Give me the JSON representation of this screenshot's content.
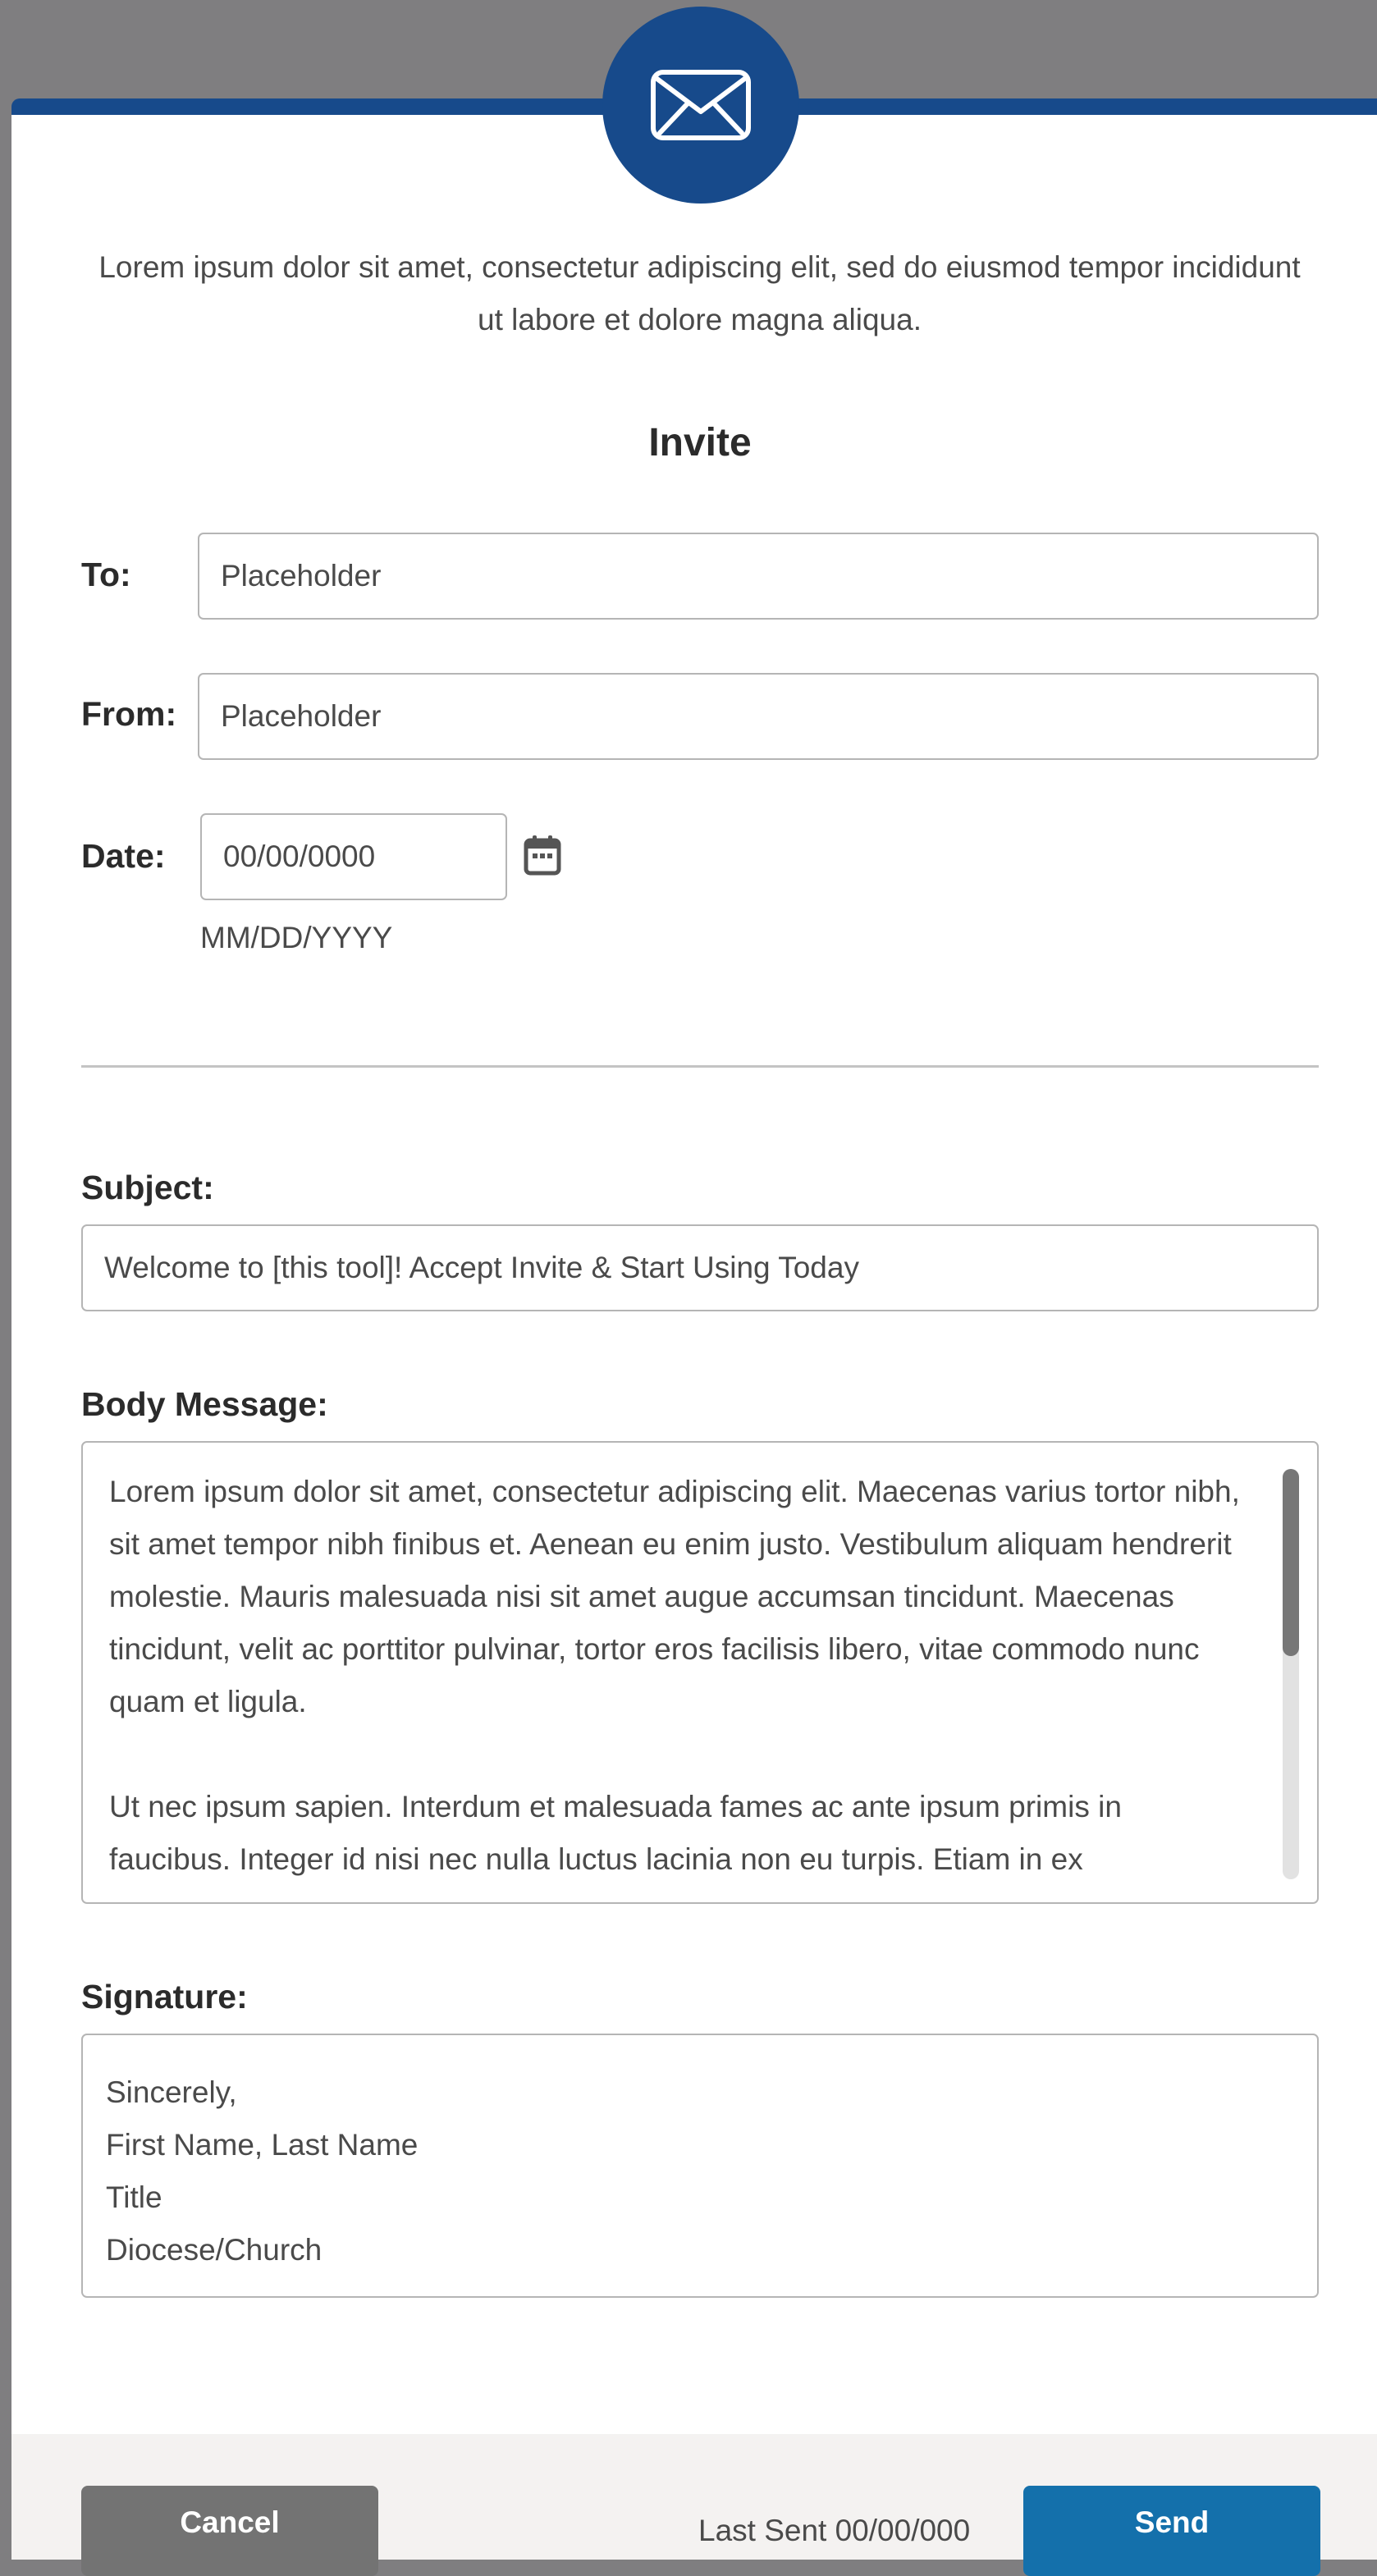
{
  "intro_text": "Lorem ipsum dolor sit amet, consectetur adipiscing elit, sed do eiusmod tempor incididunt ut labore et dolore magna aliqua.",
  "form": {
    "title": "Invite",
    "to": {
      "label": "To:",
      "placeholder": "Placeholder"
    },
    "from": {
      "label": "From:",
      "placeholder": "Placeholder"
    },
    "date": {
      "label": "Date:",
      "value": "00/00/0000",
      "hint": "MM/DD/YYYY",
      "icon": "calendar-icon"
    }
  },
  "subject": {
    "label": "Subject:",
    "value": "Welcome to [this tool]! Accept Invite & Start Using Today"
  },
  "body_message": {
    "label": "Body Message:",
    "paragraphs": [
      "Lorem ipsum dolor sit amet, consectetur adipiscing elit. Maecenas varius tortor nibh, sit amet tempor nibh finibus et. Aenean eu enim justo. Vestibulum aliquam hendrerit molestie. Mauris malesuada nisi sit amet augue accumsan tincidunt. Maecenas tincidunt, velit ac porttitor pulvinar, tortor eros facilisis libero, vitae commodo nunc quam et ligula.",
      "Ut nec ipsum sapien. Interdum et malesuada fames ac ante ipsum primis in faucibus. Integer id nisi nec nulla luctus lacinia non eu turpis. Etiam in ex"
    ]
  },
  "signature": {
    "label": "Signature:",
    "lines": [
      "Sincerely,",
      "First Name, Last Name",
      "Title",
      "Diocese/Church"
    ]
  },
  "footer": {
    "cancel_label": "Cancel",
    "send_label": "Send",
    "last_sent": "Last Sent 00/00/000"
  },
  "colors": {
    "brand_blue": "#174a8b",
    "send_blue": "#1470ab",
    "cancel_gray": "#737373",
    "overlay": "#7f7e80"
  },
  "icons": {
    "header": "envelope-icon"
  }
}
